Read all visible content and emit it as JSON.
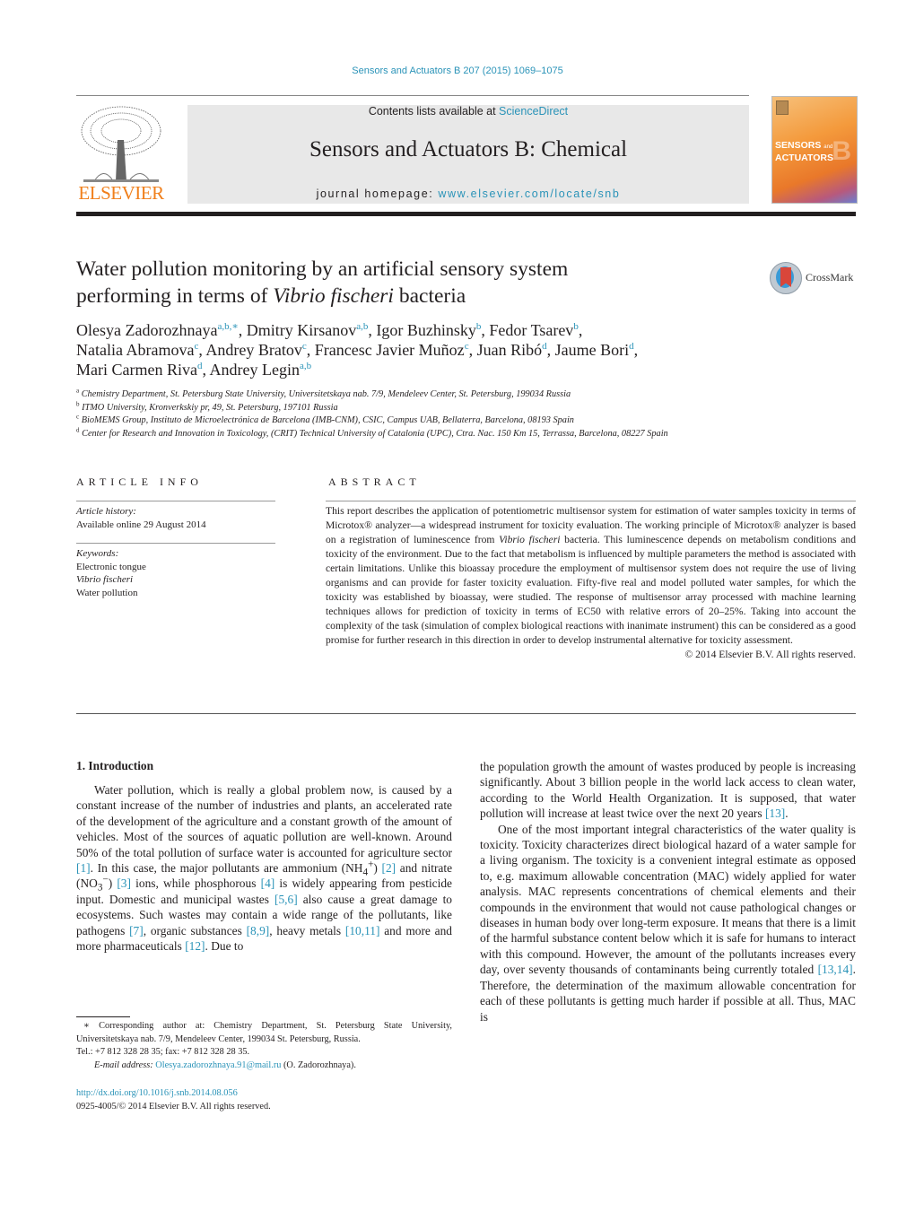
{
  "header": {
    "journal_ref": "Sensors and Actuators B 207 (2015) 1069–1075",
    "contents_prefix": "Contents lists available at ",
    "contents_link": "ScienceDirect",
    "journal_title": "Sensors and Actuators B: Chemical",
    "homepage_prefix": "journal homepage: ",
    "homepage_link": "www.elsevier.com/locate/snb",
    "publisher_logo": "ELSEVIER",
    "cover_title_1": "SENSORS",
    "cover_title_and": "and",
    "cover_title_2": "ACTUATORS",
    "cover_letter": "B"
  },
  "crossmark": {
    "label": "CrossMark"
  },
  "article": {
    "title_line1": "Water pollution monitoring by an artificial sensory system",
    "title_line2_pre": "performing in terms of ",
    "title_line2_italic": "Vibrio fischeri",
    "title_line2_post": " bacteria",
    "authors": [
      {
        "name": "Olesya Zadorozhnaya",
        "aff": "a,b,∗",
        "sep": ", "
      },
      {
        "name": "Dmitry Kirsanov",
        "aff": "a,b",
        "sep": ", "
      },
      {
        "name": "Igor Buzhinsky",
        "aff": "b",
        "sep": ", "
      },
      {
        "name": "Fedor Tsarev",
        "aff": "b",
        "sep": ","
      },
      {
        "name": "Natalia Abramova",
        "aff": "c",
        "sep": ", "
      },
      {
        "name": "Andrey Bratov",
        "aff": "c",
        "sep": ", "
      },
      {
        "name": "Francesc Javier Muñoz",
        "aff": "c",
        "sep": ", "
      },
      {
        "name": "Juan Ribó",
        "aff": "d",
        "sep": ", "
      },
      {
        "name": "Jaume Bori",
        "aff": "d",
        "sep": ","
      },
      {
        "name": "Mari Carmen Riva",
        "aff": "d",
        "sep": ", "
      },
      {
        "name": "Andrey Legin",
        "aff": "a,b",
        "sep": ""
      }
    ],
    "affiliations": [
      {
        "key": "a",
        "text": "Chemistry Department, St. Petersburg State University, Universitetskaya nab. 7/9, Mendeleev Center, St. Petersburg, 199034 Russia"
      },
      {
        "key": "b",
        "text": "ITMO University, Kronverkskiy pr, 49, St. Petersburg, 197101 Russia"
      },
      {
        "key": "c",
        "text": "BioMEMS Group, Instituto de Microelectrónica de Barcelona (IMB-CNM), CSIC, Campus UAB, Bellaterra, Barcelona, 08193 Spain"
      },
      {
        "key": "d",
        "text": "Center for Research and Innovation in Toxicology, (CRIT) Technical University of Catalonia (UPC), Ctra. Nac. 150 Km 15, Terrassa, Barcelona, 08227 Spain"
      }
    ]
  },
  "article_info": {
    "heading": "ARTICLE INFO",
    "history_label": "Article history:",
    "history_value": "Available online 29 August 2014",
    "keywords_label": "Keywords:",
    "keywords": [
      "Electronic tongue",
      "Vibrio fischeri",
      "Water pollution"
    ]
  },
  "abstract": {
    "heading": "ABSTRACT",
    "p1": "This report describes the application of potentiometric multisensor system for estimation of water samples toxicity in terms of Microtox® analyzer—a widespread instrument for toxicity evaluation. The working principle of Microtox® analyzer is based on a registration of luminescence from ",
    "p1_italic": "Vibrio fischeri",
    "p2": " bacteria. This luminescence depends on metabolism conditions and toxicity of the environment. Due to the fact that metabolism is influenced by multiple parameters the method is associated with certain limitations. Unlike this bioassay procedure the employment of multisensor system does not require the use of living organisms and can provide for faster toxicity evaluation. Fifty-five real and model polluted water samples, for which the toxicity was established by bioassay, were studied. The response of multisensor array processed with machine learning techniques allows for prediction of toxicity in terms of EC50 with relative errors of 20–25%. Taking into account the complexity of the task (simulation of complex biological reactions with inanimate instrument) this can be considered as a good promise for further research in this direction in order to develop instrumental alternative for toxicity assessment.",
    "copyright": "© 2014 Elsevier B.V. All rights reserved."
  },
  "body": {
    "section_title": "1.  Introduction",
    "col1": {
      "s1": "Water pollution, which is really a global problem now, is caused by a constant increase of the number of industries and plants, an accelerated rate of the development of the agriculture and a constant growth of the amount of vehicles. Most of the sources of aquatic pollution are well-known. Around 50% of the total pollution of surface water is accounted for agriculture sector ",
      "r1": "[1]",
      "s2": ". In this case, the major pollutants are ammonium (NH",
      "s2_sub": "4",
      "s2_sup": "+",
      "s2b": ") ",
      "r2": "[2]",
      "s3": " and nitrate (NO",
      "s3_sub": "3",
      "s3_sup": "−",
      "s3b": ") ",
      "r3": "[3]",
      "s4": " ions, while phosphorous ",
      "r4": "[4]",
      "s5": " is widely appearing from pesticide input. Domestic and municipal wastes ",
      "r5": "[5,6]",
      "s6": " also cause a great damage to ecosystems. Such wastes may contain a wide range of the pollutants, like pathogens ",
      "r6": "[7]",
      "s7": ", organic substances ",
      "r7": "[8,9]",
      "s8": ", heavy metals ",
      "r8": "[10,11]",
      "s9": " and more and more pharmaceuticals ",
      "r9": "[12]",
      "s10": ". Due to"
    },
    "col2": {
      "p1a": "the population growth the amount of wastes produced by people is increasing significantly. About 3 billion people in the world lack access to clean water, according to the World Health Organization. It is supposed, that water pollution will increase at least twice over the next 20 years ",
      "r1": "[13]",
      "p1b": ".",
      "p2a": "One of the most important integral characteristics of the water quality is toxicity. Toxicity characterizes direct biological hazard of a water sample for a living organism. The toxicity is a convenient integral estimate as opposed to, e.g. maximum allowable concentration (MAC) widely applied for water analysis. MAC represents concentrations of chemical elements and their compounds in the environment that would not cause pathological changes or diseases in human body over long-term exposure. It means that there is a limit of the harmful substance content below which it is safe for humans to interact with this compound. However, the amount of the pollutants increases every day, over seventy thousands of contaminants being currently totaled ",
      "r2": "[13,14]",
      "p2b": ". Therefore, the determination of the maximum allowable concentration for each of these pollutants is getting much harder if possible at all. Thus, MAC is"
    }
  },
  "footnote": {
    "corresponding": "∗ Corresponding author at: Chemistry Department, St. Petersburg State University, Universitetskaya nab. 7/9, Mendeleev Center, 199034 St. Petersburg, Russia.",
    "tel": "Tel.: +7 812 328 28 35; fax: +7 812 328 28 35.",
    "email_label": "E-mail address: ",
    "email": "Olesya.zadorozhnaya.91@mail.ru",
    "email_suffix": " (O. Zadorozhnaya).",
    "doi": "http://dx.doi.org/10.1016/j.snb.2014.08.056",
    "issn": "0925-4005/© 2014 Elsevier B.V. All rights reserved."
  }
}
